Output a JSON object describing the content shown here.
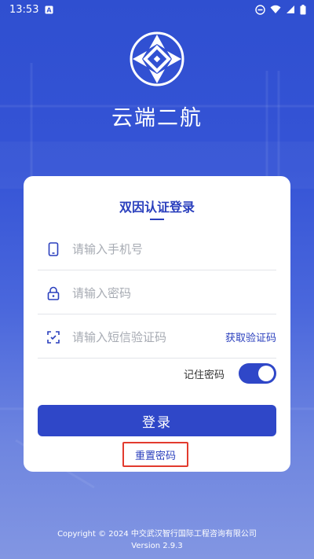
{
  "status_bar": {
    "time": "13:53",
    "icons": [
      "notification-a-icon",
      "dnd-icon",
      "wifi-icon",
      "signal-icon",
      "battery-icon"
    ]
  },
  "app": {
    "name": "云端二航",
    "logo": "crossroads-logo"
  },
  "login_card": {
    "title": "双因认证登录",
    "phone": {
      "placeholder": "请输入手机号",
      "value": "",
      "icon": "phone-icon"
    },
    "password": {
      "placeholder": "请输入密码",
      "value": "",
      "icon": "lock-icon"
    },
    "sms_code": {
      "placeholder": "请输入短信验证码",
      "value": "",
      "icon": "scan-code-icon"
    },
    "get_code_label": "获取验证码",
    "remember_label": "记住密码",
    "remember_on": true,
    "login_label": "登录",
    "reset_label": "重置密码"
  },
  "footer": {
    "copyright": "Copyright © 2024 中交武汉智行国际工程咨询有限公司",
    "version": "Version 2.9.3"
  },
  "colors": {
    "primary": "#2f47c8",
    "title": "#2a3fbd",
    "highlight_box": "#e23b2e"
  }
}
